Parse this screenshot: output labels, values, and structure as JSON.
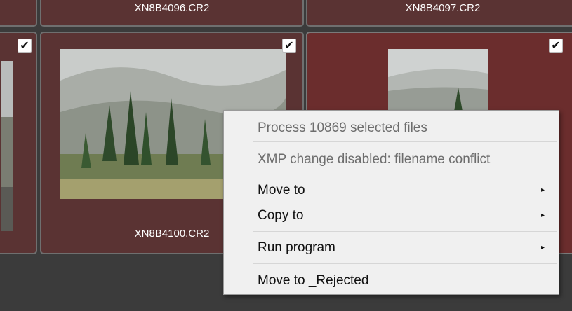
{
  "grid": {
    "top_row_labels": [
      "XN8B4096.CR2",
      "XN8B4097.CR2"
    ],
    "tiles": [
      {
        "label": "",
        "checked": true
      },
      {
        "label": "XN8B4100.CR2",
        "checked": true
      },
      {
        "label": "",
        "checked": true
      }
    ],
    "check_glyph": "✔"
  },
  "context_menu": {
    "items": [
      {
        "label": "Process 10869 selected files",
        "disabled": true,
        "submenu": false
      },
      {
        "label": "XMP change disabled: filename conflict",
        "disabled": true,
        "submenu": false
      },
      {
        "label": "Move to",
        "disabled": false,
        "submenu": true
      },
      {
        "label": "Copy to",
        "disabled": false,
        "submenu": true
      },
      {
        "label": "Run program",
        "disabled": false,
        "submenu": true
      },
      {
        "label": "Move to _Rejected",
        "disabled": false,
        "submenu": false
      }
    ],
    "submenu_arrow": "▸"
  },
  "colors": {
    "background": "#3b3b3b",
    "tile_bg": "#5a3333",
    "tile_selected_bg": "#6b2d2d",
    "menu_bg": "#f0f0f0"
  }
}
